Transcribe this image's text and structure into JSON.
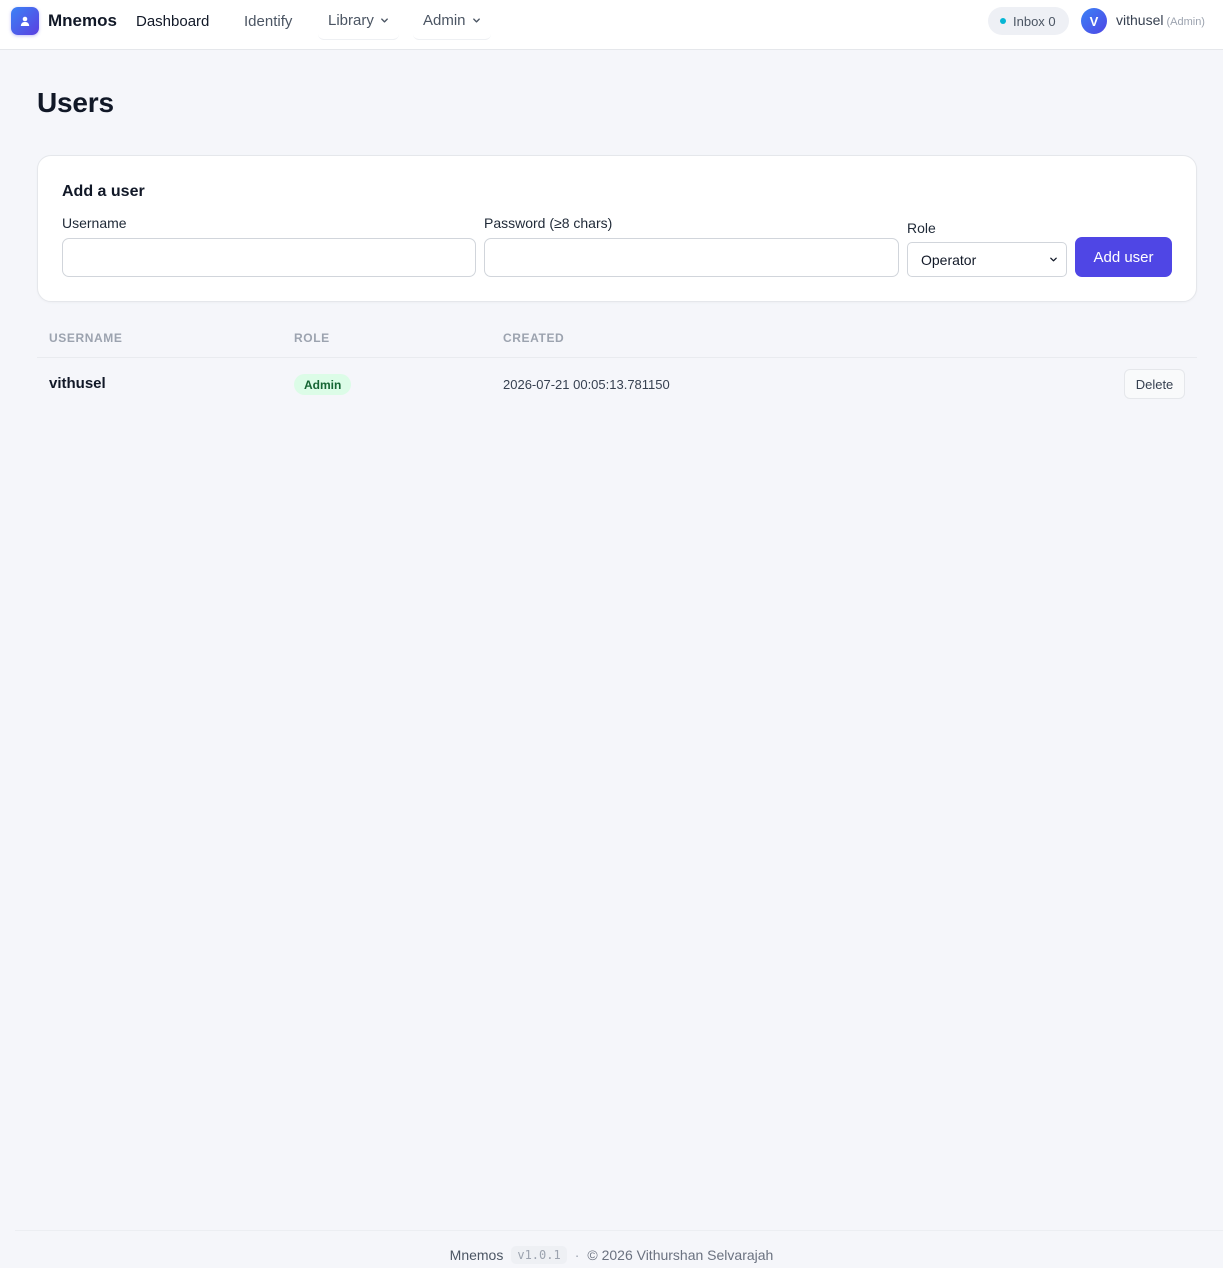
{
  "app": {
    "brand": "Mnemos",
    "logo_icon": "person-icon",
    "accent_color": "#4f46e5"
  },
  "nav": {
    "dashboard": "Dashboard",
    "identify": "Identify",
    "library": "Library",
    "admin": "Admin"
  },
  "header": {
    "inbox_label": "Inbox 0",
    "avatar_initial": "V",
    "username": "vithusel",
    "role": "(Admin)"
  },
  "page": {
    "title": "Users"
  },
  "add_user_form": {
    "title": "Add a user",
    "username_label": "Username",
    "username_value": "",
    "password_label": "Password (≥8 chars)",
    "password_value": "",
    "role_label": "Role",
    "role_selected": "Operator",
    "submit_label": "Add user"
  },
  "users_table": {
    "columns": [
      "USERNAME",
      "ROLE",
      "CREATED"
    ],
    "rows": [
      {
        "username": "vithusel",
        "role": "Admin",
        "created": "2026-07-21 00:05:13.781150",
        "action_label": "Delete"
      }
    ]
  },
  "footer": {
    "brand": "Mnemos",
    "version": "v1.0.1",
    "separator": "·",
    "copyright": "© 2026 Vithurshan Selvarajah"
  }
}
